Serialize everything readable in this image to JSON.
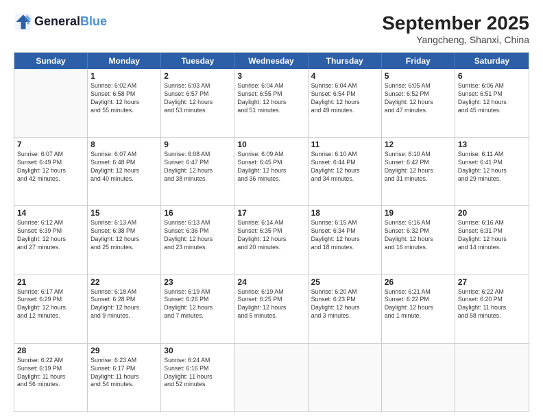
{
  "header": {
    "logo_line1": "General",
    "logo_line2": "Blue",
    "month_year": "September 2025",
    "location": "Yangcheng, Shanxi, China"
  },
  "days_of_week": [
    "Sunday",
    "Monday",
    "Tuesday",
    "Wednesday",
    "Thursday",
    "Friday",
    "Saturday"
  ],
  "weeks": [
    [
      {
        "day": "",
        "info": ""
      },
      {
        "day": "1",
        "info": "Sunrise: 6:02 AM\nSunset: 6:58 PM\nDaylight: 12 hours\nand 55 minutes."
      },
      {
        "day": "2",
        "info": "Sunrise: 6:03 AM\nSunset: 6:57 PM\nDaylight: 12 hours\nand 53 minutes."
      },
      {
        "day": "3",
        "info": "Sunrise: 6:04 AM\nSunset: 6:55 PM\nDaylight: 12 hours\nand 51 minutes."
      },
      {
        "day": "4",
        "info": "Sunrise: 6:04 AM\nSunset: 6:54 PM\nDaylight: 12 hours\nand 49 minutes."
      },
      {
        "day": "5",
        "info": "Sunrise: 6:05 AM\nSunset: 6:52 PM\nDaylight: 12 hours\nand 47 minutes."
      },
      {
        "day": "6",
        "info": "Sunrise: 6:06 AM\nSunset: 6:51 PM\nDaylight: 12 hours\nand 45 minutes."
      }
    ],
    [
      {
        "day": "7",
        "info": "Sunrise: 6:07 AM\nSunset: 6:49 PM\nDaylight: 12 hours\nand 42 minutes."
      },
      {
        "day": "8",
        "info": "Sunrise: 6:07 AM\nSunset: 6:48 PM\nDaylight: 12 hours\nand 40 minutes."
      },
      {
        "day": "9",
        "info": "Sunrise: 6:08 AM\nSunset: 6:47 PM\nDaylight: 12 hours\nand 38 minutes."
      },
      {
        "day": "10",
        "info": "Sunrise: 6:09 AM\nSunset: 6:45 PM\nDaylight: 12 hours\nand 36 minutes."
      },
      {
        "day": "11",
        "info": "Sunrise: 6:10 AM\nSunset: 6:44 PM\nDaylight: 12 hours\nand 34 minutes."
      },
      {
        "day": "12",
        "info": "Sunrise: 6:10 AM\nSunset: 6:42 PM\nDaylight: 12 hours\nand 31 minutes."
      },
      {
        "day": "13",
        "info": "Sunrise: 6:11 AM\nSunset: 6:41 PM\nDaylight: 12 hours\nand 29 minutes."
      }
    ],
    [
      {
        "day": "14",
        "info": "Sunrise: 6:12 AM\nSunset: 6:39 PM\nDaylight: 12 hours\nand 27 minutes."
      },
      {
        "day": "15",
        "info": "Sunrise: 6:13 AM\nSunset: 6:38 PM\nDaylight: 12 hours\nand 25 minutes."
      },
      {
        "day": "16",
        "info": "Sunrise: 6:13 AM\nSunset: 6:36 PM\nDaylight: 12 hours\nand 23 minutes."
      },
      {
        "day": "17",
        "info": "Sunrise: 6:14 AM\nSunset: 6:35 PM\nDaylight: 12 hours\nand 20 minutes."
      },
      {
        "day": "18",
        "info": "Sunrise: 6:15 AM\nSunset: 6:34 PM\nDaylight: 12 hours\nand 18 minutes."
      },
      {
        "day": "19",
        "info": "Sunrise: 6:16 AM\nSunset: 6:32 PM\nDaylight: 12 hours\nand 16 minutes."
      },
      {
        "day": "20",
        "info": "Sunrise: 6:16 AM\nSunset: 6:31 PM\nDaylight: 12 hours\nand 14 minutes."
      }
    ],
    [
      {
        "day": "21",
        "info": "Sunrise: 6:17 AM\nSunset: 6:29 PM\nDaylight: 12 hours\nand 12 minutes."
      },
      {
        "day": "22",
        "info": "Sunrise: 6:18 AM\nSunset: 6:28 PM\nDaylight: 12 hours\nand 9 minutes."
      },
      {
        "day": "23",
        "info": "Sunrise: 6:19 AM\nSunset: 6:26 PM\nDaylight: 12 hours\nand 7 minutes."
      },
      {
        "day": "24",
        "info": "Sunrise: 6:19 AM\nSunset: 6:25 PM\nDaylight: 12 hours\nand 5 minutes."
      },
      {
        "day": "25",
        "info": "Sunrise: 6:20 AM\nSunset: 6:23 PM\nDaylight: 12 hours\nand 3 minutes."
      },
      {
        "day": "26",
        "info": "Sunrise: 6:21 AM\nSunset: 6:22 PM\nDaylight: 12 hours\nand 1 minute."
      },
      {
        "day": "27",
        "info": "Sunrise: 6:22 AM\nSunset: 6:20 PM\nDaylight: 11 hours\nand 58 minutes."
      }
    ],
    [
      {
        "day": "28",
        "info": "Sunrise: 6:22 AM\nSunset: 6:19 PM\nDaylight: 11 hours\nand 56 minutes."
      },
      {
        "day": "29",
        "info": "Sunrise: 6:23 AM\nSunset: 6:17 PM\nDaylight: 11 hours\nand 54 minutes."
      },
      {
        "day": "30",
        "info": "Sunrise: 6:24 AM\nSunset: 6:16 PM\nDaylight: 11 hours\nand 52 minutes."
      },
      {
        "day": "",
        "info": ""
      },
      {
        "day": "",
        "info": ""
      },
      {
        "day": "",
        "info": ""
      },
      {
        "day": "",
        "info": ""
      }
    ]
  ]
}
